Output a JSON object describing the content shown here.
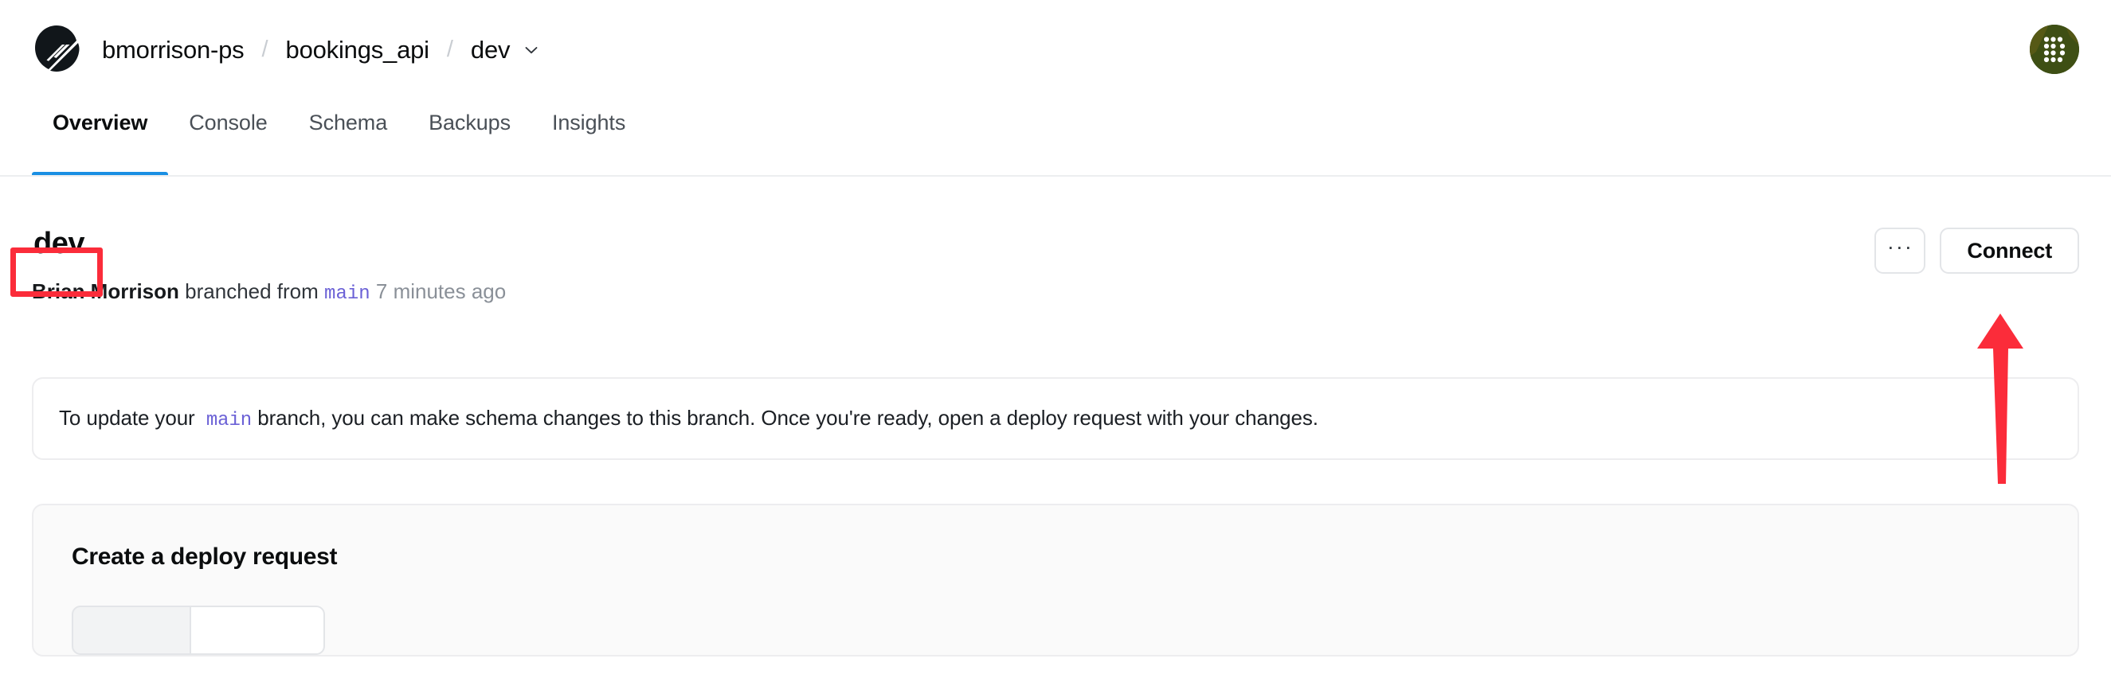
{
  "header": {
    "logo_icon": "planetscale-logo-icon",
    "breadcrumb": {
      "org": "bmorrison-ps",
      "separator": "/",
      "database": "bookings_api",
      "branch": "dev",
      "branch_chevron_icon": "chevron-down-icon"
    },
    "avatar": {
      "name": "user-avatar",
      "background_color": "#3d4f15"
    }
  },
  "tabs": {
    "active": "Overview",
    "items": [
      {
        "label": "Overview"
      },
      {
        "label": "Console"
      },
      {
        "label": "Schema"
      },
      {
        "label": "Backups"
      },
      {
        "label": "Insights"
      }
    ],
    "active_underline_color": "#1a8fe3"
  },
  "branch": {
    "title": "dev",
    "meta": {
      "author": "Brian Morrison",
      "action": "branched from",
      "parent_branch": "main",
      "time": "7 minutes ago"
    },
    "actions": {
      "more_label": "···",
      "more_icon": "ellipsis-icon",
      "connect_label": "Connect"
    }
  },
  "info_banner": {
    "text_before": "To update your",
    "branch_name": "main",
    "text_after": "branch, you can make schema changes to this branch. Once you're ready, open a deploy request with your changes."
  },
  "deploy_request": {
    "title": "Create a deploy request",
    "segment_one": "",
    "segment_two": ""
  },
  "annotations": {
    "highlight_color": "#fb2c3a",
    "box_target": "branch-title",
    "arrow_target": "connect-button"
  }
}
